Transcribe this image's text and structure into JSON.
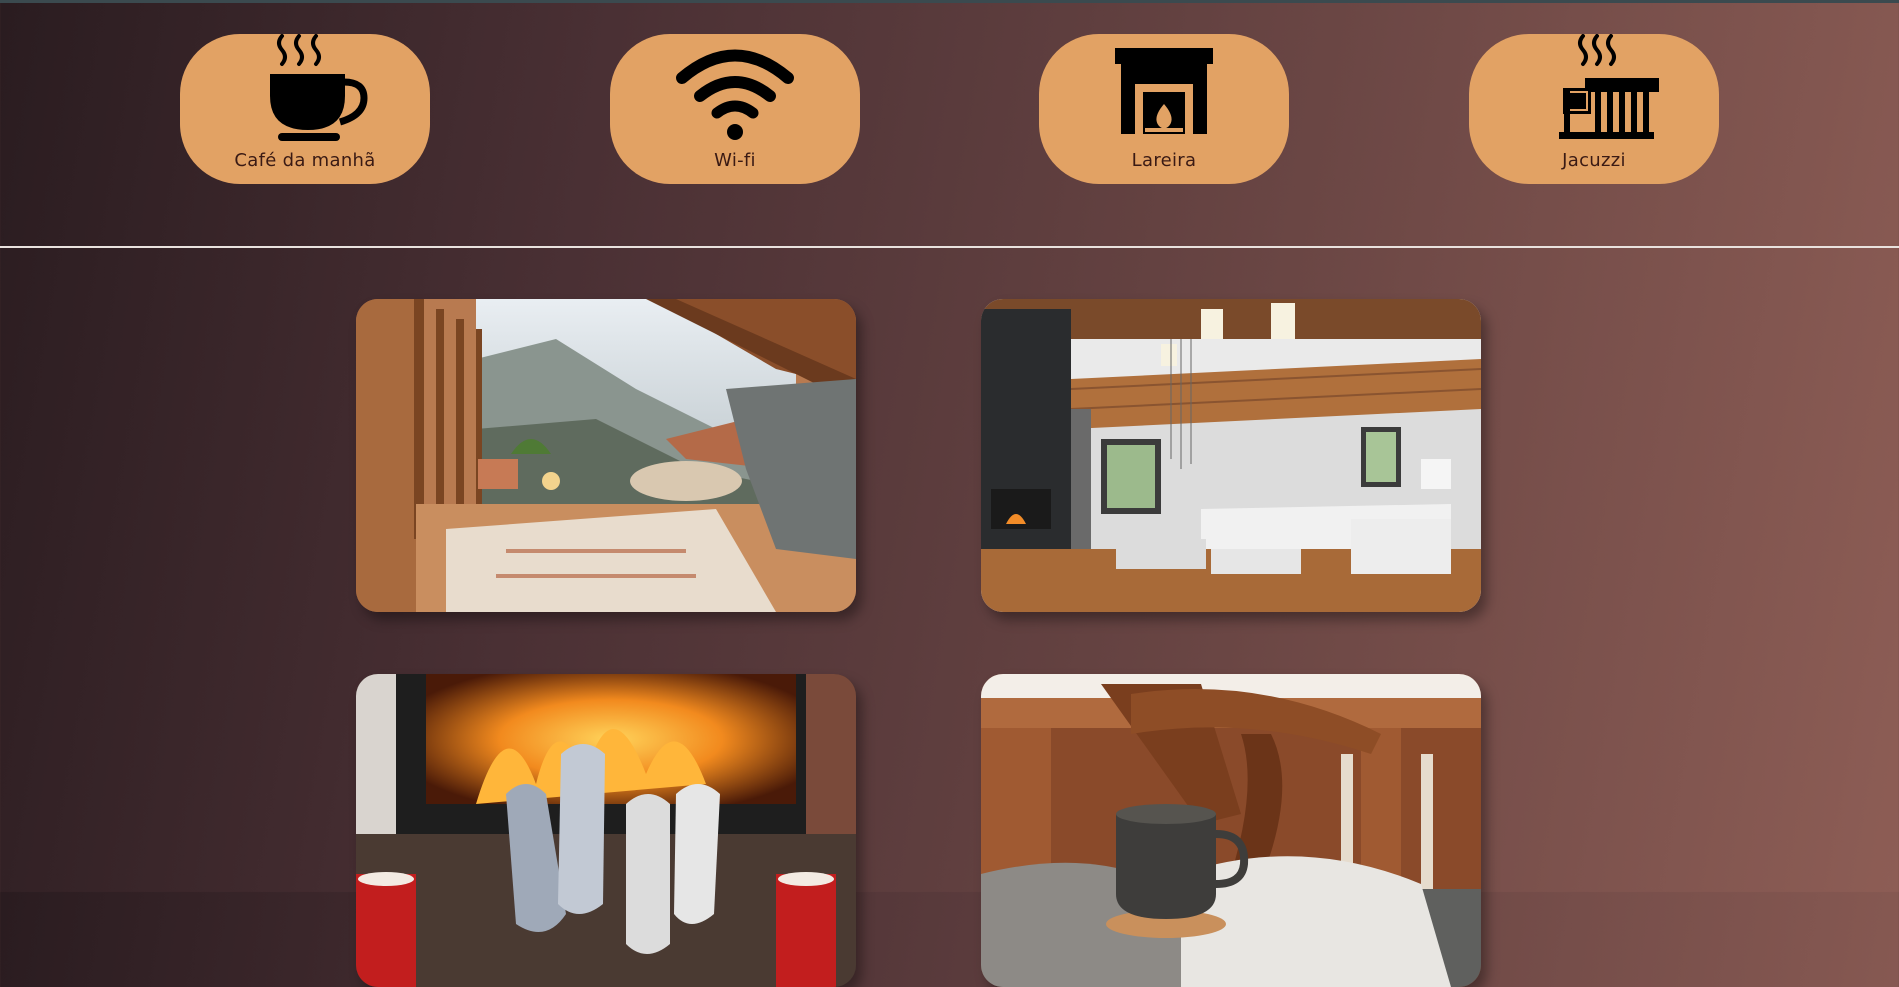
{
  "amenities": [
    {
      "label": "Café da manhã",
      "icon": "coffee-cup-icon"
    },
    {
      "label": "Wi-fi",
      "icon": "wifi-icon"
    },
    {
      "label": "Lareira",
      "icon": "fireplace-icon"
    },
    {
      "label": "Jacuzzi",
      "icon": "jacuzzi-icon"
    }
  ],
  "gallery": [
    {
      "name": "photo-attic-balcony"
    },
    {
      "name": "photo-living-room"
    },
    {
      "name": "photo-fireplace-socks"
    },
    {
      "name": "photo-coffee-on-porch"
    }
  ],
  "colors": {
    "amenity_bg": "#e2a264",
    "label_text": "#3a1a14",
    "divider": "#e9e2de"
  }
}
